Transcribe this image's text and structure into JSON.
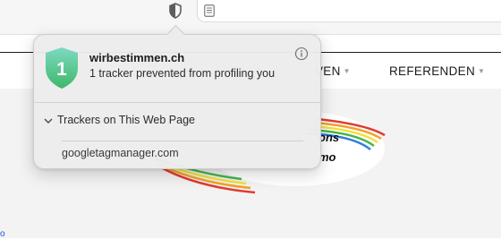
{
  "toolbar": {
    "privacy_report_icon": "shield-icon",
    "reader_icon": "reader-mode-icon"
  },
  "site_nav": {
    "items": [
      {
        "label": "VEN"
      },
      {
        "label": "REFERENDEN"
      }
    ]
  },
  "site_logo": {
    "text_line_1": "ons",
    "text_line_2": "mo"
  },
  "page_link": {
    "text": "o"
  },
  "popover": {
    "tracker_count": "1",
    "site_name": "wirbestimmen.ch",
    "summary": "1 tracker prevented from profiling you",
    "section_title": "Trackers on This Web Page",
    "trackers": [
      "googletagmanager.com"
    ],
    "badge_colors": {
      "top": "#7ed9c2",
      "bottom": "#3fb869"
    }
  }
}
